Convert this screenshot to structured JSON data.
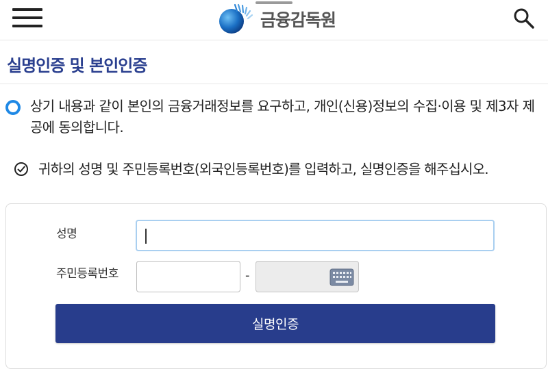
{
  "header": {
    "menu_icon": "hamburger-menu-icon",
    "logo_text": "금융감독원",
    "search_icon": "search-icon"
  },
  "page": {
    "title": "실명인증 및 본인인증"
  },
  "consent": {
    "text": "상기 내용과 같이 본인의 금융거래정보를 요구하고, 개인(신용)정보의 수집·이용 및 제3자 제공에 동의합니다.",
    "selected": true
  },
  "notice": {
    "icon": "check-circle-icon",
    "text": "귀하의 성명 및 주민등록번호(외국인등록번호)를 입력하고, 실명인증을 해주십시오."
  },
  "form": {
    "name_label": "성명",
    "name_value": "",
    "rrn_label": "주민등록번호",
    "rrn_front_value": "",
    "rrn_separator": "-",
    "rrn_back_icon": "keyboard-icon",
    "submit_label": "실명인증"
  },
  "colors": {
    "brand_navy": "#283d8c",
    "title_blue": "#2a3f8f",
    "radio_blue": "#1e88e5",
    "focus_border": "#a9cff0"
  }
}
